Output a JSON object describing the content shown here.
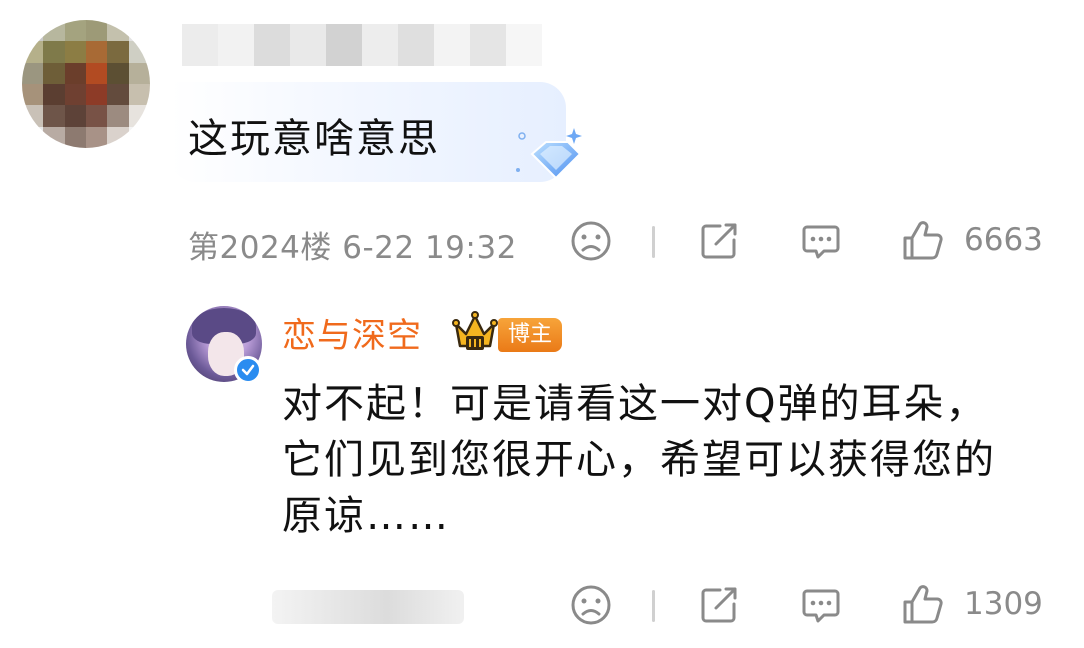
{
  "top_comment": {
    "text": "这玩意啥意思",
    "floor_time": "第2024楼 6-22 19:32",
    "likes": "6663",
    "icons": [
      "dislike-face-icon",
      "share-icon",
      "comment-icon",
      "like-thumb-icon"
    ],
    "bubble_decoration": "diamond-gem-icon"
  },
  "reply": {
    "author": "恋与深空",
    "badge": "博主",
    "text": "对不起！可是请看这一对Q弹的耳朵，它们见到您很开心，希望可以获得您的原谅……",
    "likes": "1309",
    "icons": [
      "dislike-face-icon",
      "share-icon",
      "comment-icon",
      "like-thumb-icon"
    ]
  },
  "colors": {
    "author_name": "#f06a1c",
    "meta_gray": "#8a8a8a",
    "badge_orange": "#ea7a17",
    "verified_blue": "#2a8cf0"
  }
}
